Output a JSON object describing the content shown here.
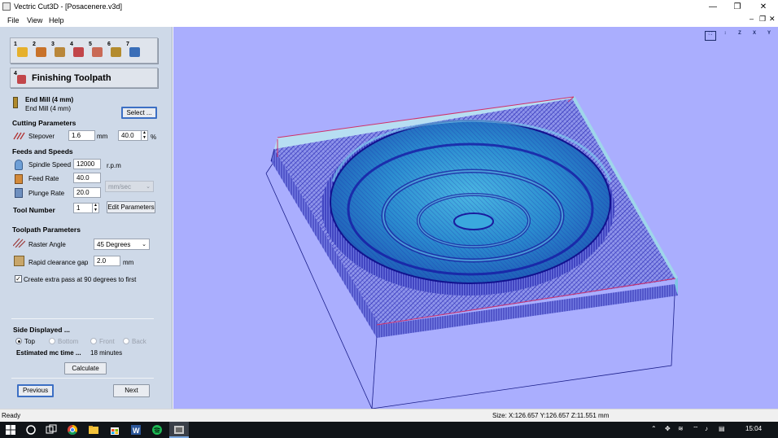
{
  "window": {
    "title": "Vectric Cut3D - [Posacenere.v3d]",
    "minimize": "—",
    "restore": "❐",
    "close": "✕"
  },
  "menu": {
    "items": [
      "File",
      "View",
      "Help"
    ],
    "mdi_minimize": "–",
    "mdi_restore": "❐",
    "mdi_close": "✕"
  },
  "toolbar": {
    "steps": [
      "1",
      "2",
      "3",
      "4",
      "5",
      "6",
      "7"
    ]
  },
  "panel": {
    "header_title": "Finishing Toolpath",
    "header_step": "4",
    "tool": {
      "name_bold": "End Mill (4 mm)",
      "name_sub": "End Mill (4 mm)",
      "select_button": "Select ..."
    },
    "cutting": {
      "section": "Cutting Parameters",
      "stepover_label": "Stepover",
      "stepover_value": "1.6",
      "stepover_unit": "mm",
      "stepover_percent": "40.0",
      "percent_sign": "%"
    },
    "feeds": {
      "section": "Feeds and Speeds",
      "spindle_label": "Spindle Speed",
      "spindle_value": "12000",
      "spindle_unit": "r.p.m",
      "feed_label": "Feed Rate",
      "feed_value": "40.0",
      "plunge_label": "Plunge Rate",
      "plunge_value": "20.0",
      "rate_unit": "mm/sec"
    },
    "tool_number": {
      "label": "Tool Number",
      "value": "1",
      "edit_button": "Edit Parameters"
    },
    "toolpath": {
      "section": "Toolpath Parameters",
      "raster_label": "Raster Angle",
      "raster_value": "45 Degrees",
      "clearance_label": "Rapid clearance gap",
      "clearance_value": "2.0",
      "clearance_unit": "mm",
      "extra_pass_label": "Create extra pass at 90 degrees to first",
      "extra_pass_checked": true,
      "check_mark": "✓"
    },
    "side": {
      "section": "Side Displayed ...",
      "options": [
        "Top",
        "Bottom",
        "Front",
        "Back"
      ],
      "selected": "Top",
      "estimate_label": "Estimated mc time ...",
      "estimate_value": "18 minutes",
      "calculate_button": "Calculate"
    },
    "nav": {
      "previous": "Previous",
      "next": "Next"
    }
  },
  "viewport": {
    "tools": [
      "fit-view",
      "iso-view",
      "z-view",
      "x-view",
      "y-view"
    ],
    "tool_labels": [
      "⛶",
      "↕",
      "Z",
      "X",
      "Y"
    ]
  },
  "status": {
    "left": "Ready",
    "size": "Size: X:126.657 Y:126.657 Z:11.551 mm"
  },
  "taskbar": {
    "time": "15:04",
    "apps": [
      "start",
      "cortana",
      "task-view",
      "chrome",
      "file-explorer",
      "store",
      "word",
      "spotify",
      "cut3d"
    ]
  },
  "colors": {
    "viewport_bg": "#aaaefe",
    "mesh": "#1c1cb8",
    "surface": "#2fa6d8",
    "panel_bg": "#ced9e8",
    "bounds_red": "#d0306a"
  }
}
